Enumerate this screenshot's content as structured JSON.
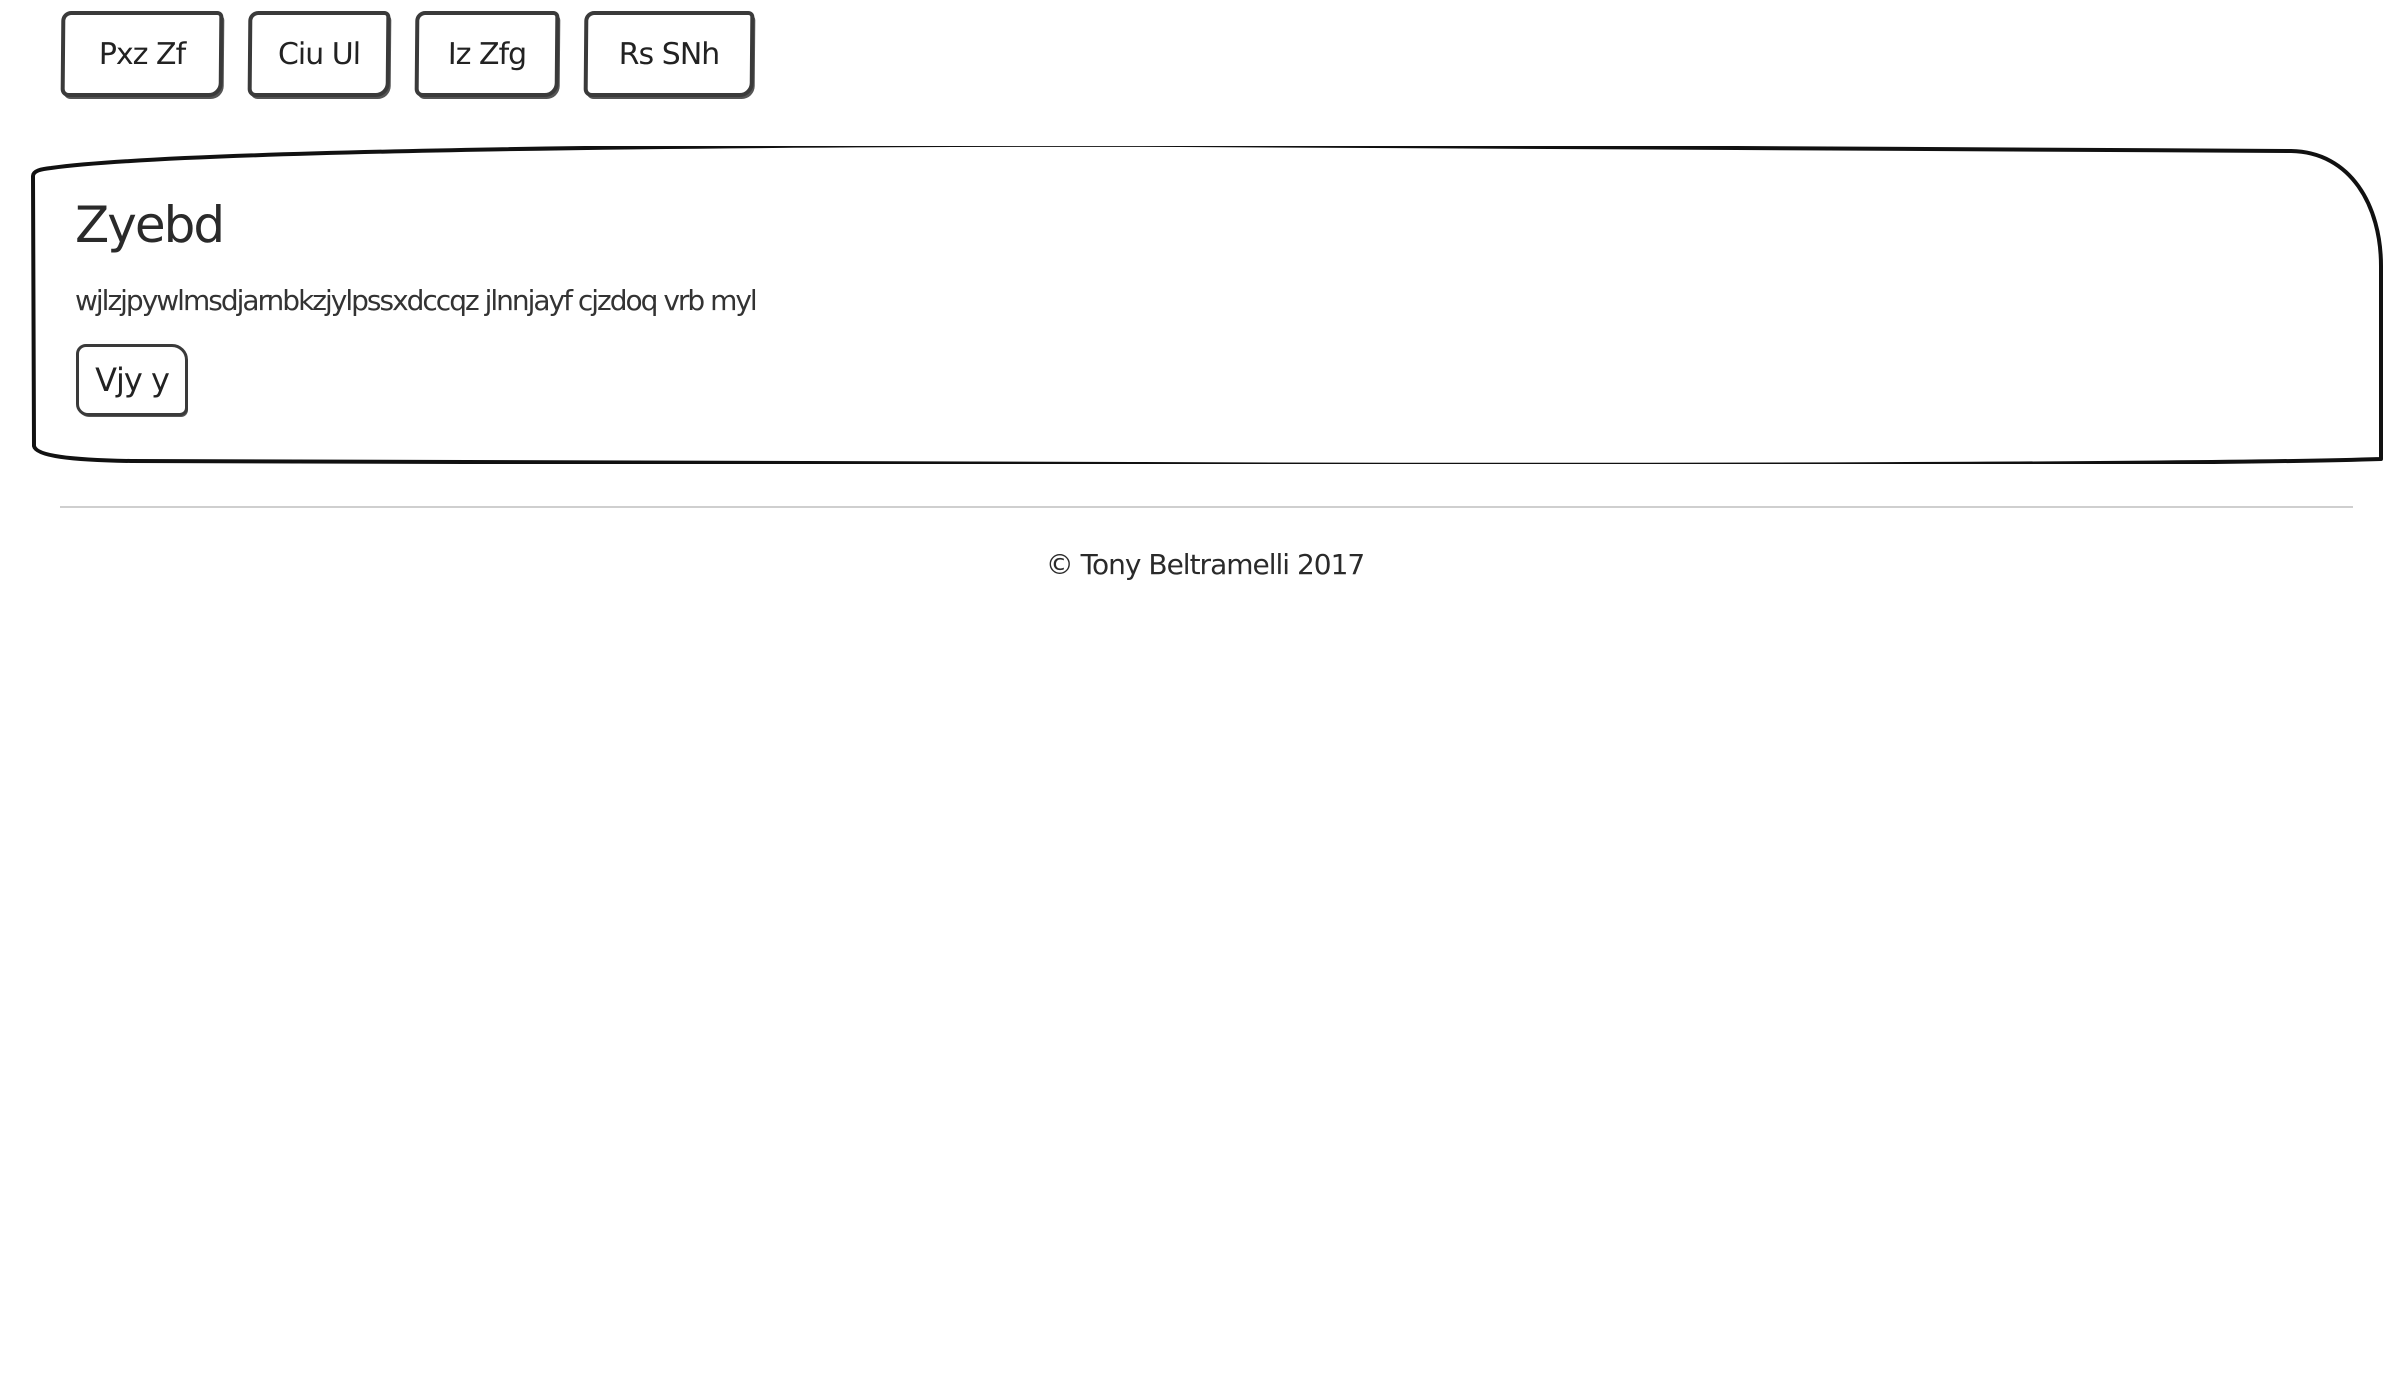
{
  "nav": {
    "buttons": [
      {
        "label": "Pxz Zf"
      },
      {
        "label": "Ciu Ul"
      },
      {
        "label": "Iz Zfg"
      },
      {
        "label": "Rs SNh"
      }
    ]
  },
  "jumbotron": {
    "title": "Zyebd",
    "text": "wjlzjpywlmsdjarnbkzjylpssxdccqz jlnnjayf cjzdoq vrb myl",
    "button_label": "Vjy y"
  },
  "footer": {
    "copyright": "© Tony Beltramelli 2017"
  }
}
